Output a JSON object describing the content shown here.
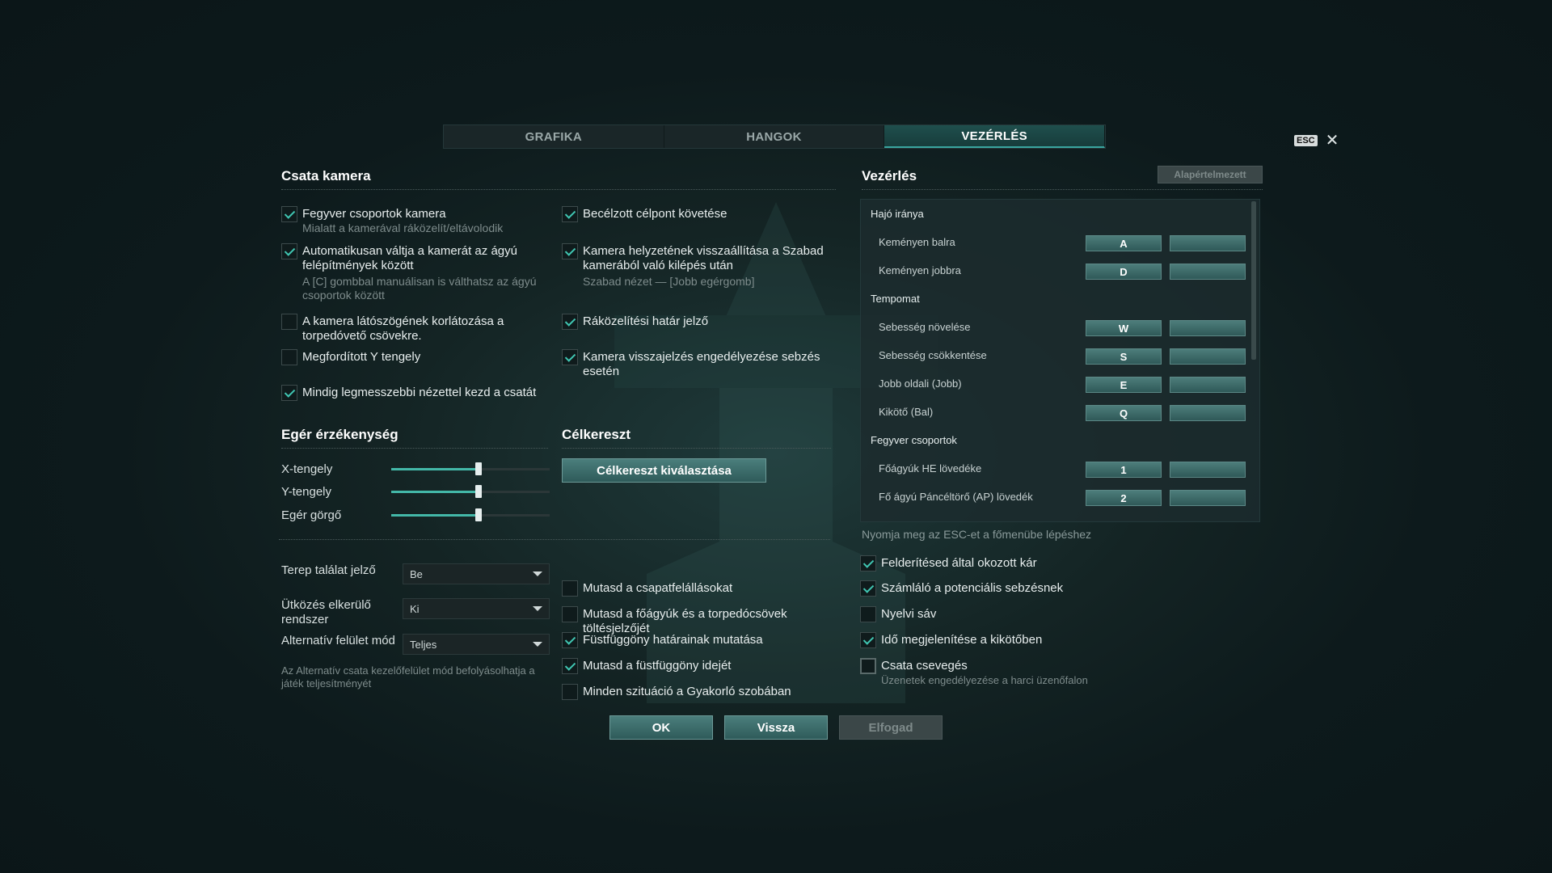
{
  "tabs": [
    {
      "label": "GRAFIKA",
      "active": false
    },
    {
      "label": "HANGOK",
      "active": false
    },
    {
      "label": "VEZÉRLÉS",
      "active": true
    }
  ],
  "esc_label": "ESC",
  "close_symbol": "✕",
  "camera": {
    "title": "Csata kamera",
    "left_options": [
      {
        "label": "Fegyver csoportok kamera",
        "sub": "Mialatt a kamerával ráközelít/eltávolodik",
        "checked": true
      },
      {
        "label": "Automatikusan váltja a kamerát az ágyú felépítmények között",
        "sub": "A [C] gombbal manuálisan is válthatsz az ágyú csoportok között",
        "checked": true
      },
      {
        "label": "A kamera látószögének korlátozása a torpedóvető csövekre.",
        "sub": "",
        "checked": false
      },
      {
        "label": "Megfordított Y tengely",
        "sub": "",
        "checked": false
      },
      {
        "label": "Mindig legmesszebbi nézettel kezd a csatát",
        "sub": "",
        "checked": true
      }
    ],
    "right_options": [
      {
        "label": "Becélzott célpont követése",
        "sub": "",
        "checked": true
      },
      {
        "label": "Kamera helyzetének visszaállítása a Szabad kamerából való kilépés után",
        "sub": "Szabad nézet — [Jobb egérgomb]",
        "checked": true
      },
      {
        "label": "Ráközelítési határ jelző",
        "sub": "",
        "checked": true
      },
      {
        "label": "Kamera visszajelzés engedélyezése sebzés esetén",
        "sub": "",
        "checked": true
      }
    ]
  },
  "mouse": {
    "title": "Egér érzékenység",
    "sliders": [
      {
        "label": "X-tengely",
        "value": 0.55
      },
      {
        "label": "Y-tengely",
        "value": 0.55
      },
      {
        "label": "Egér görgő",
        "value": 0.55
      }
    ]
  },
  "crosshair": {
    "title": "Célkereszt",
    "button": "Célkereszt kiválasztása"
  },
  "dropdowns": [
    {
      "label": "Terep találat jelző",
      "value": "Be"
    },
    {
      "label": "Ütközés elkerülő rendszer",
      "value": "Ki"
    },
    {
      "label": "Alternatív felület mód",
      "value": "Teljes"
    }
  ],
  "alt_note": "Az Alternatív csata kezelőfelület mód befolyásolhatja a játék teljesítményét",
  "middle_options": [
    {
      "label": "Mutasd a csapatfelállásokat",
      "checked": false
    },
    {
      "label": "Mutasd a főágyúk és a torpedócsövek töltésjelzőjét",
      "checked": false
    },
    {
      "label": "Füstfüggöny határainak mutatása",
      "checked": true
    },
    {
      "label": "Mutasd a füstfüggöny idejét",
      "checked": true
    },
    {
      "label": "Minden szituáció a Gyakorló szobában",
      "checked": false
    }
  ],
  "controls": {
    "title": "Vezérlés",
    "default_button": "Alapértelmezett",
    "groups": [
      {
        "name": "Hajó iránya",
        "rows": [
          {
            "label": "Keményen balra",
            "key1": "A",
            "key2": ""
          },
          {
            "label": "Keményen jobbra",
            "key1": "D",
            "key2": ""
          }
        ]
      },
      {
        "name": "Tempomat",
        "rows": [
          {
            "label": "Sebesség növelése",
            "key1": "W",
            "key2": ""
          },
          {
            "label": "Sebesség csökkentése",
            "key1": "S",
            "key2": ""
          },
          {
            "label": "Jobb oldali (Jobb)",
            "key1": "E",
            "key2": ""
          },
          {
            "label": "Kikötő (Bal)",
            "key1": "Q",
            "key2": ""
          }
        ]
      },
      {
        "name": "Fegyver csoportok",
        "rows": [
          {
            "label": "Főágyúk HE lövedéke",
            "key1": "1",
            "key2": ""
          },
          {
            "label": "Fő ágyú Páncéltörő (AP) lövedék",
            "key1": "2",
            "key2": ""
          }
        ]
      }
    ],
    "hint": "Nyomja meg az ESC-et a főmenübe lépéshez"
  },
  "right_options": [
    {
      "label": "Felderítéseď által okozott kár",
      "sub": "",
      "checked": true
    },
    {
      "label": "Számláló a potenciális sebzésnek",
      "sub": "",
      "checked": true
    },
    {
      "label": "Nyelvi sáv",
      "sub": "",
      "checked": false
    },
    {
      "label": "Idő megjelenítése a kikötőben",
      "sub": "",
      "checked": true
    },
    {
      "label": "Csata csevegés",
      "sub": "Üzenetek engedélyezése a harci üzenőfalon",
      "checked": false
    }
  ],
  "footer": {
    "ok": "OK",
    "back": "Vissza",
    "apply": "Elfogad"
  }
}
